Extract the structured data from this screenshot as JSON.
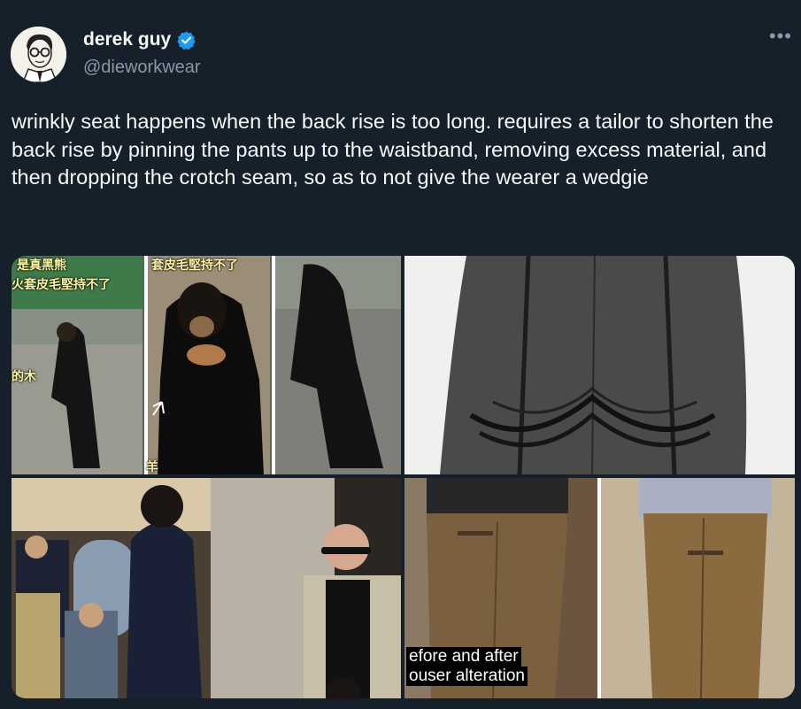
{
  "author": {
    "name": "derek guy",
    "handle": "@dieworkwear",
    "verified": true,
    "verified_color": "#1d9bf0"
  },
  "more_icon": "•••",
  "tweet": {
    "text": "wrinkly seat happens when the back rise is too long. requires a tailor to shorten the back rise by pinning the pants up to the waistband, removing excess material, and then dropping the crotch seam, so as to not give the wearer a wedgie"
  },
  "media": {
    "bear_captions": {
      "left_top": "是真黑熊",
      "left_mid": "火套皮毛堅持不了",
      "left_low": "的木",
      "center_top": "套皮毛堅持不了",
      "center_bottom": "羊"
    },
    "video_caption_line1": "efore and after",
    "video_caption_line2": "ouser alteration"
  }
}
